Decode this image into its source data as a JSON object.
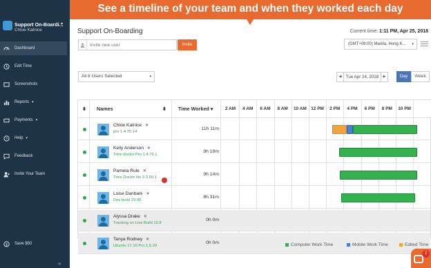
{
  "banner": {
    "text": "See a timeline of your team and when they worked each day"
  },
  "sidebar": {
    "team_name": "Support On-Boardi...",
    "user_name": "Chloe Katnice",
    "items": [
      {
        "label": "Dashboard",
        "icon": "gauge-icon",
        "active": true
      },
      {
        "label": "Edit Time",
        "icon": "clock-icon"
      },
      {
        "label": "Screenshots",
        "icon": "screenshot-icon"
      },
      {
        "label": "Reports",
        "icon": "chart-icon",
        "caret": "▾"
      },
      {
        "label": "Payments",
        "icon": "payments-icon",
        "caret": "▾"
      },
      {
        "label": "Help",
        "icon": "help-icon",
        "caret": "▾"
      },
      {
        "label": "Feedback",
        "icon": "feedback-icon"
      },
      {
        "label": "Invite Your Team",
        "icon": "invite-icon"
      },
      {
        "label": "Save $50",
        "icon": "gift-icon"
      }
    ],
    "collapse_glyph": "«"
  },
  "header": {
    "title": "Support On-Boarding",
    "current_time_label": "Current time:",
    "current_time_value": "1:11 PM, Apr 25, 2018",
    "invite_placeholder": "Invite new user",
    "invite_button": "Invite",
    "timezone": "(GMT+08:00) Manila, Hong K..."
  },
  "toolbar": {
    "users_filter": "All 6 Users Selected",
    "date": "Tue Apr 24, 2018",
    "prev": "◀",
    "next": "▶",
    "day_button": "Day",
    "week_button": "Week"
  },
  "table": {
    "headers": {
      "sort": "⬍",
      "names": "Names",
      "time_worked": "Time Worked"
    },
    "hours": [
      "2 AM",
      "4 AM",
      "6 AM",
      "8 AM",
      "10 AM",
      "12 PM",
      "2 PM",
      "4 PM",
      "6 PM",
      "8 PM",
      "10 PM"
    ],
    "rows": [
      {
        "name": "Chloe Katnice",
        "sub": "pro 1.4.75.14",
        "time": "11h 11m",
        "shade": false,
        "segments": [
          {
            "type": "edited",
            "start": 13.7,
            "end": 15.4
          },
          {
            "type": "mobile",
            "start": 15.4,
            "end": 16.1
          },
          {
            "type": "computer",
            "start": 16.1,
            "end": 23.5
          }
        ]
      },
      {
        "name": "Kelly Anderson",
        "sub": "Time doctor Pro 1.4.76.1",
        "time": "9h 19m",
        "shade": false,
        "segments": [
          {
            "type": "computer",
            "start": 14.5,
            "end": 23.5
          }
        ]
      },
      {
        "name": "Pamela Rule",
        "sub": "Time Doctor lite 2.3.50.1",
        "time": "9h 14m",
        "shade": false,
        "segments": [
          {
            "type": "computer",
            "start": 14.6,
            "end": 23.5
          }
        ]
      },
      {
        "name": "Loise Danbark",
        "sub": "Dev build 19.08",
        "time": "8h 31m",
        "shade": false,
        "segments": [
          {
            "type": "computer",
            "start": 14.7,
            "end": 23.2
          }
        ]
      },
      {
        "name": "Alyssa Drake",
        "sub": "Tracking on Live Build 19.8",
        "time": "0h 0m",
        "shade": true,
        "segments": []
      },
      {
        "name": "Tanya Rodney",
        "sub": "Ubuntu 17.10 Pro 1.5.20",
        "time": "0h 0m",
        "shade": true,
        "segments": []
      }
    ]
  },
  "legend": [
    {
      "label": "Computer Work Time",
      "color": "#35b24f"
    },
    {
      "label": "Mobile Work Time",
      "color": "#4b7fd0"
    },
    {
      "label": "Edited Time",
      "color": "#f2a33a"
    }
  ],
  "chat": {
    "badge": "2"
  },
  "colors": {
    "accent": "#e86a2e",
    "sidebar": "#1f3346",
    "computer": "#35b24f",
    "mobile": "#4b7fd0",
    "edited": "#f2a33a"
  }
}
